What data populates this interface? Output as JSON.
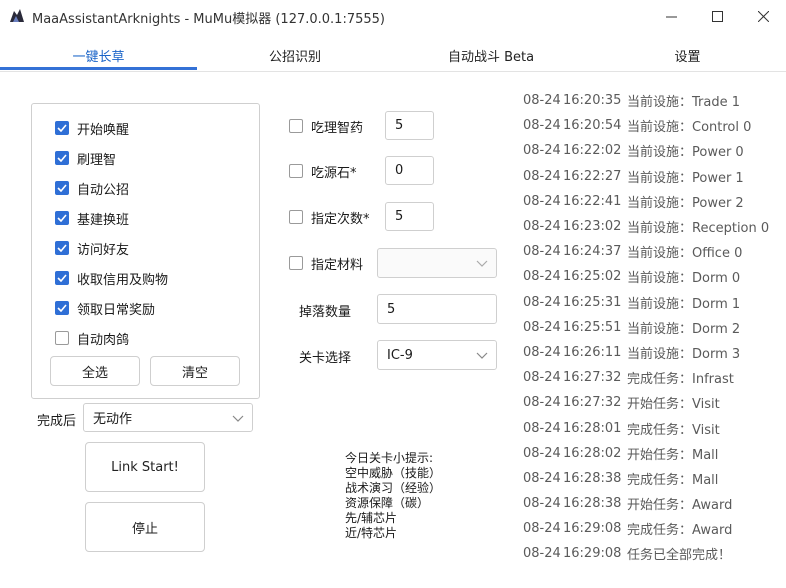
{
  "window": {
    "title": "MaaAssistantArknights - MuMu模拟器 (127.0.0.1:7555)"
  },
  "tabs": [
    {
      "label": "一键长草",
      "active": true
    },
    {
      "label": "公招识别",
      "active": false
    },
    {
      "label": "自动战斗 Beta",
      "active": false
    },
    {
      "label": "设置",
      "active": false
    }
  ],
  "tasks": {
    "items": [
      {
        "label": "开始唤醒",
        "checked": true
      },
      {
        "label": "刷理智",
        "checked": true
      },
      {
        "label": "自动公招",
        "checked": true
      },
      {
        "label": "基建换班",
        "checked": true
      },
      {
        "label": "访问好友",
        "checked": true
      },
      {
        "label": "收取信用及购物",
        "checked": true
      },
      {
        "label": "领取日常奖励",
        "checked": true
      },
      {
        "label": "自动肉鸽",
        "checked": false
      }
    ],
    "select_all_label": "全选",
    "clear_label": "清空"
  },
  "after_finish": {
    "label": "完成后",
    "value": "无动作"
  },
  "actions": {
    "start_label": "Link Start!",
    "stop_label": "停止"
  },
  "fight": {
    "medicine": {
      "label": "吃理智药",
      "checked": false,
      "value": "5"
    },
    "stone": {
      "label": "吃源石*",
      "checked": false,
      "value": "0"
    },
    "times": {
      "label": "指定次数*",
      "checked": false,
      "value": "5"
    },
    "material": {
      "label": "指定材料",
      "checked": false,
      "value": ""
    },
    "drop_count": {
      "label": "掉落数量",
      "value": "5"
    },
    "stage": {
      "label": "关卡选择",
      "value": "IC-9"
    }
  },
  "tips": [
    "今日关卡小提示:",
    "空中威胁（技能）",
    "战术演习（经验）",
    "资源保障（碳）",
    "先/辅芯片",
    "近/特芯片"
  ],
  "log": [
    {
      "date": "08-24",
      "time": "16:20:35",
      "msg": "当前设施：Trade 1"
    },
    {
      "date": "08-24",
      "time": "16:20:54",
      "msg": "当前设施：Control 0"
    },
    {
      "date": "08-24",
      "time": "16:22:02",
      "msg": "当前设施：Power 0"
    },
    {
      "date": "08-24",
      "time": "16:22:27",
      "msg": "当前设施：Power 1"
    },
    {
      "date": "08-24",
      "time": "16:22:41",
      "msg": "当前设施：Power 2"
    },
    {
      "date": "08-24",
      "time": "16:23:02",
      "msg": "当前设施：Reception 0"
    },
    {
      "date": "08-24",
      "time": "16:24:37",
      "msg": "当前设施：Office 0"
    },
    {
      "date": "08-24",
      "time": "16:25:02",
      "msg": "当前设施：Dorm 0"
    },
    {
      "date": "08-24",
      "time": "16:25:31",
      "msg": "当前设施：Dorm 1"
    },
    {
      "date": "08-24",
      "time": "16:25:51",
      "msg": "当前设施：Dorm 2"
    },
    {
      "date": "08-24",
      "time": "16:26:11",
      "msg": "当前设施：Dorm 3"
    },
    {
      "date": "08-24",
      "time": "16:27:32",
      "msg": "完成任务：Infrast"
    },
    {
      "date": "08-24",
      "time": "16:27:32",
      "msg": "开始任务：Visit"
    },
    {
      "date": "08-24",
      "time": "16:28:01",
      "msg": "完成任务：Visit"
    },
    {
      "date": "08-24",
      "time": "16:28:02",
      "msg": "开始任务：Mall"
    },
    {
      "date": "08-24",
      "time": "16:28:38",
      "msg": "完成任务：Mall"
    },
    {
      "date": "08-24",
      "time": "16:28:38",
      "msg": "开始任务：Award"
    },
    {
      "date": "08-24",
      "time": "16:29:08",
      "msg": "完成任务：Award"
    },
    {
      "date": "08-24",
      "time": "16:29:08",
      "msg": "任务已全部完成！"
    }
  ],
  "colors": {
    "accent": "#3471d6",
    "checkbox_checked": "#2f6fd6",
    "log_text": "#5a5a5a",
    "border": "#cfcfcf"
  },
  "icons": {
    "app": "app-logo-icon",
    "minimize": "minimize-icon",
    "maximize": "maximize-icon",
    "close": "close-icon",
    "check": "check-icon",
    "dropdown": "chevron-down-icon"
  }
}
